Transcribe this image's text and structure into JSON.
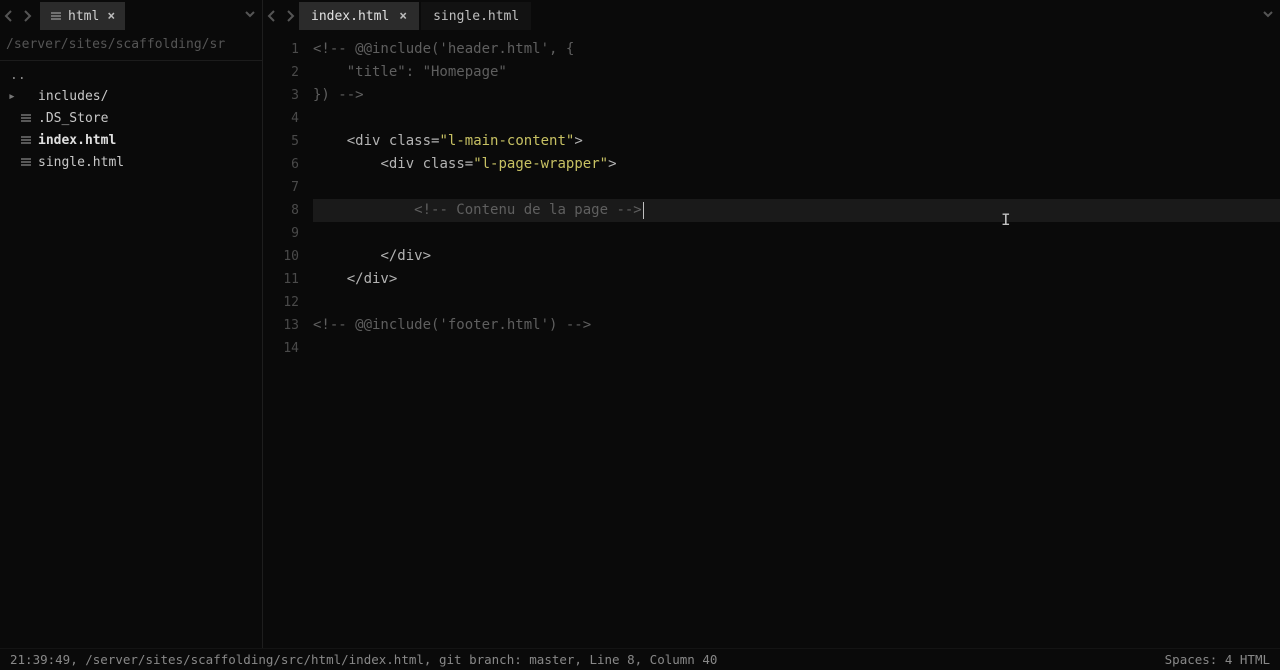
{
  "sidebar": {
    "tab_label": "html",
    "breadcrumb": "/server/sites/scaffolding/sr",
    "parent_dir": "..",
    "tree": [
      {
        "label": "includes/",
        "type": "folder",
        "bold": false
      },
      {
        "label": ".DS_Store",
        "type": "file",
        "bold": false
      },
      {
        "label": "index.html",
        "type": "file",
        "bold": true
      },
      {
        "label": "single.html",
        "type": "file",
        "bold": false
      }
    ]
  },
  "editor": {
    "tabs": [
      {
        "label": "index.html",
        "active": true,
        "dirty": true
      },
      {
        "label": "single.html",
        "active": false,
        "dirty": false
      }
    ],
    "current_line": 8,
    "lines": [
      {
        "n": 1,
        "tokens": [
          {
            "t": "<!-- @@include('header.html', {",
            "c": "comment"
          }
        ]
      },
      {
        "n": 2,
        "tokens": [
          {
            "t": "    \"title\": \"Homepage\"",
            "c": "comment"
          }
        ]
      },
      {
        "n": 3,
        "tokens": [
          {
            "t": "}) -->",
            "c": "comment"
          }
        ]
      },
      {
        "n": 4,
        "tokens": []
      },
      {
        "n": 5,
        "tokens": [
          {
            "t": "    ",
            "c": "plain"
          },
          {
            "t": "<",
            "c": "punct"
          },
          {
            "t": "div",
            "c": "tag"
          },
          {
            "t": " ",
            "c": "plain"
          },
          {
            "t": "class",
            "c": "attr"
          },
          {
            "t": "=",
            "c": "punct"
          },
          {
            "t": "\"l-main-content\"",
            "c": "string"
          },
          {
            "t": ">",
            "c": "punct"
          }
        ]
      },
      {
        "n": 6,
        "tokens": [
          {
            "t": "        ",
            "c": "plain"
          },
          {
            "t": "<",
            "c": "punct"
          },
          {
            "t": "div",
            "c": "tag"
          },
          {
            "t": " ",
            "c": "plain"
          },
          {
            "t": "class",
            "c": "attr"
          },
          {
            "t": "=",
            "c": "punct"
          },
          {
            "t": "\"l-page-wrapper\"",
            "c": "string"
          },
          {
            "t": ">",
            "c": "punct"
          }
        ]
      },
      {
        "n": 7,
        "tokens": []
      },
      {
        "n": 8,
        "tokens": [
          {
            "t": "            ",
            "c": "plain"
          },
          {
            "t": "<!-- Contenu de la page -->",
            "c": "comment"
          }
        ]
      },
      {
        "n": 9,
        "tokens": []
      },
      {
        "n": 10,
        "tokens": [
          {
            "t": "        ",
            "c": "plain"
          },
          {
            "t": "</",
            "c": "punct"
          },
          {
            "t": "div",
            "c": "tag"
          },
          {
            "t": ">",
            "c": "punct"
          }
        ]
      },
      {
        "n": 11,
        "tokens": [
          {
            "t": "    ",
            "c": "plain"
          },
          {
            "t": "</",
            "c": "punct"
          },
          {
            "t": "div",
            "c": "tag"
          },
          {
            "t": ">",
            "c": "punct"
          }
        ]
      },
      {
        "n": 12,
        "tokens": []
      },
      {
        "n": 13,
        "tokens": [
          {
            "t": "<!-- @@include('footer.html') -->",
            "c": "comment"
          }
        ]
      },
      {
        "n": 14,
        "tokens": []
      }
    ]
  },
  "status": {
    "left": "21:39:49, /server/sites/scaffolding/src/html/index.html, git branch: master, Line 8, Column 40",
    "right": "Spaces: 4 HTML"
  }
}
